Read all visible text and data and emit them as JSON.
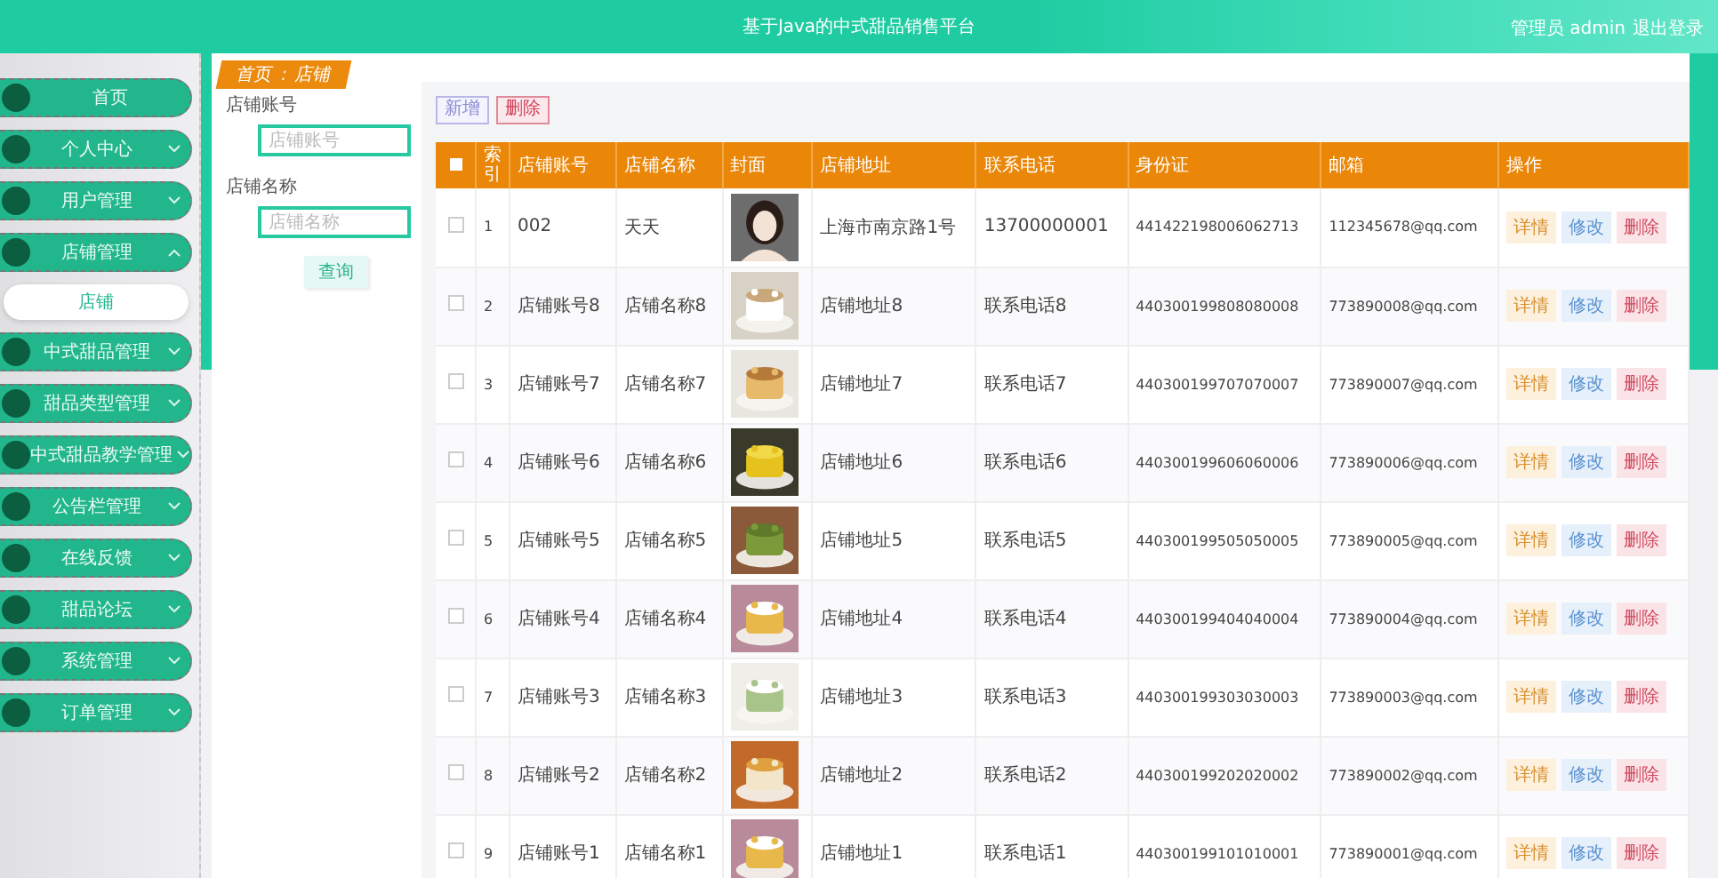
{
  "header": {
    "title": "基于Java的中式甜品销售平台",
    "user": "管理员 admin",
    "logout": "退出登录"
  },
  "sidebar": {
    "items": [
      {
        "label": "首页",
        "kind": "link"
      },
      {
        "label": "个人中心",
        "kind": "group",
        "expanded": false
      },
      {
        "label": "用户管理",
        "kind": "group",
        "expanded": false
      },
      {
        "label": "店铺管理",
        "kind": "group",
        "expanded": true,
        "children": [
          {
            "label": "店铺",
            "selected": true
          }
        ]
      },
      {
        "label": "中式甜品管理",
        "kind": "group",
        "expanded": false
      },
      {
        "label": "甜品类型管理",
        "kind": "group",
        "expanded": false
      },
      {
        "label": "中式甜品教学管理",
        "kind": "group",
        "expanded": false
      },
      {
        "label": "公告栏管理",
        "kind": "group",
        "expanded": false
      },
      {
        "label": "在线反馈",
        "kind": "group",
        "expanded": false
      },
      {
        "label": "甜品论坛",
        "kind": "group",
        "expanded": false
      },
      {
        "label": "系统管理",
        "kind": "group",
        "expanded": false
      },
      {
        "label": "订单管理",
        "kind": "group",
        "expanded": false
      }
    ]
  },
  "breadcrumb": {
    "items": [
      "首页",
      "店铺"
    ],
    "separator": ":"
  },
  "search": {
    "fields": [
      {
        "label": "店铺账号",
        "placeholder": "店铺账号"
      },
      {
        "label": "店铺名称",
        "placeholder": "店铺名称"
      }
    ],
    "button": "查询"
  },
  "toolbar": {
    "add": "新增",
    "delete": "删除"
  },
  "table": {
    "columns": [
      "索引",
      "店铺账号",
      "店铺名称",
      "封面",
      "店铺地址",
      "联系电话",
      "身份证",
      "邮箱",
      "操作"
    ],
    "select_all": {
      "checked": false
    },
    "rows": [
      {
        "checked": false,
        "index": "1",
        "account": "002",
        "name": "天天",
        "address": "上海市南京路1号",
        "phone": "13700000001",
        "id_card": "441422198006062713",
        "email": "112345678@qq.com",
        "actions": [
          "详情",
          "修改",
          "删除"
        ]
      },
      {
        "checked": false,
        "index": "2",
        "account": "店铺账号8",
        "name": "店铺名称8",
        "address": "店铺地址8",
        "phone": "联系电话8",
        "id_card": "440300199808080008",
        "email": "773890008@qq.com",
        "actions": [
          "详情",
          "修改",
          "删除"
        ]
      },
      {
        "checked": false,
        "index": "3",
        "account": "店铺账号7",
        "name": "店铺名称7",
        "address": "店铺地址7",
        "phone": "联系电话7",
        "id_card": "440300199707070007",
        "email": "773890007@qq.com",
        "actions": [
          "详情",
          "修改",
          "删除"
        ]
      },
      {
        "checked": false,
        "index": "4",
        "account": "店铺账号6",
        "name": "店铺名称6",
        "address": "店铺地址6",
        "phone": "联系电话6",
        "id_card": "440300199606060006",
        "email": "773890006@qq.com",
        "actions": [
          "详情",
          "修改",
          "删除"
        ]
      },
      {
        "checked": false,
        "index": "5",
        "account": "店铺账号5",
        "name": "店铺名称5",
        "address": "店铺地址5",
        "phone": "联系电话5",
        "id_card": "440300199505050005",
        "email": "773890005@qq.com",
        "actions": [
          "详情",
          "修改",
          "删除"
        ]
      },
      {
        "checked": false,
        "index": "6",
        "account": "店铺账号4",
        "name": "店铺名称4",
        "address": "店铺地址4",
        "phone": "联系电话4",
        "id_card": "440300199404040004",
        "email": "773890004@qq.com",
        "actions": [
          "详情",
          "修改",
          "删除"
        ]
      },
      {
        "checked": false,
        "index": "7",
        "account": "店铺账号3",
        "name": "店铺名称3",
        "address": "店铺地址3",
        "phone": "联系电话3",
        "id_card": "440300199303030003",
        "email": "773890003@qq.com",
        "actions": [
          "详情",
          "修改",
          "删除"
        ]
      },
      {
        "checked": false,
        "index": "8",
        "account": "店铺账号2",
        "name": "店铺名称2",
        "address": "店铺地址2",
        "phone": "联系电话2",
        "id_card": "440300199202020002",
        "email": "773890002@qq.com",
        "actions": [
          "详情",
          "修改",
          "删除"
        ]
      },
      {
        "checked": false,
        "index": "9",
        "account": "店铺账号1",
        "name": "店铺名称1",
        "address": "店铺地址1",
        "phone": "联系电话1",
        "id_card": "440300199101010001",
        "email": "773890001@qq.com",
        "actions": [
          "详情",
          "修改",
          "删除"
        ]
      }
    ]
  }
}
